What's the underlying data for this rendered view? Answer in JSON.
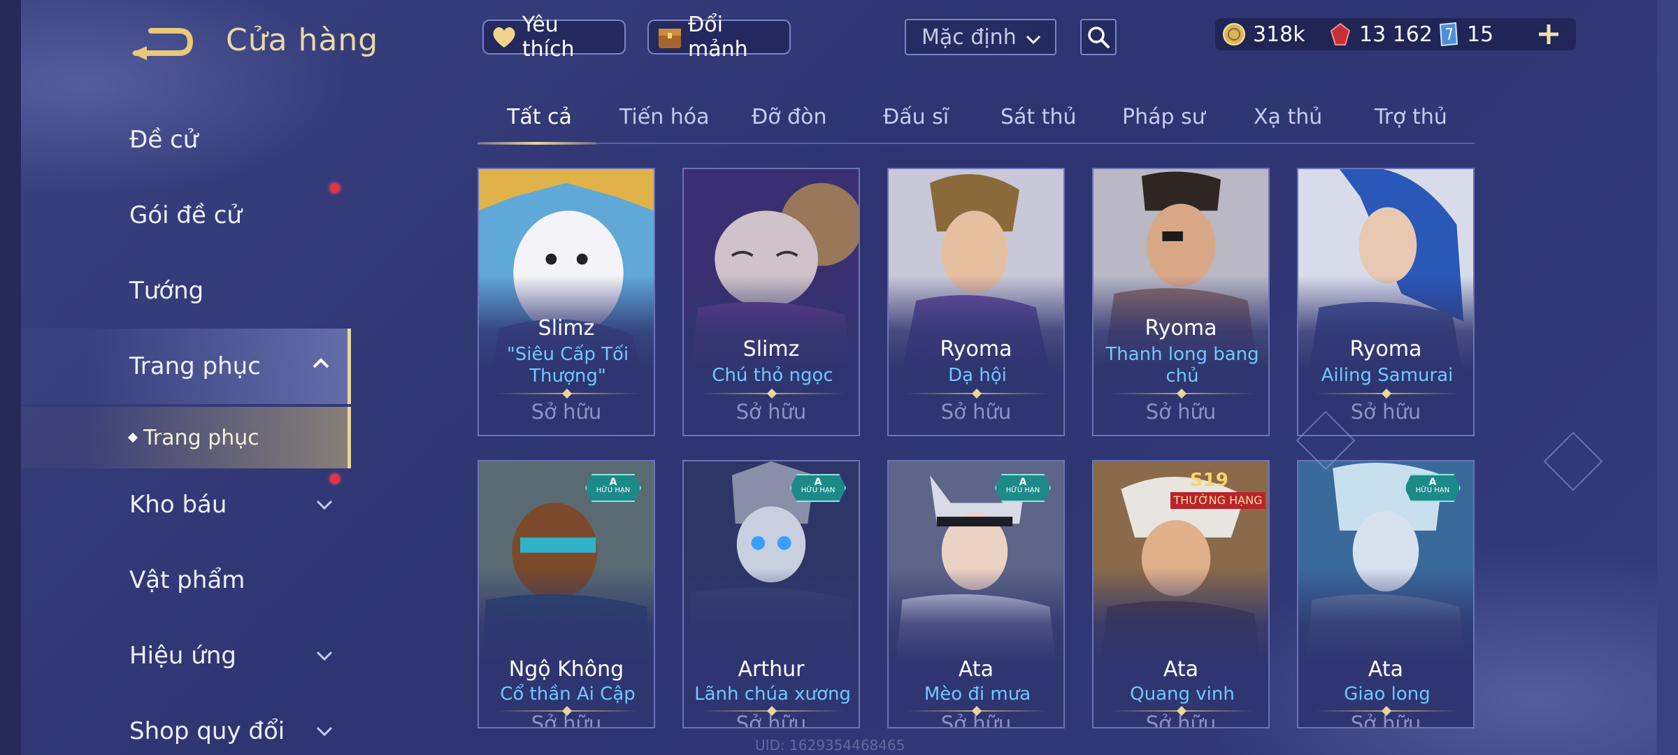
{
  "header": {
    "title": "Cửa hàng",
    "favorites_label": "Yêu thích",
    "shard_label": "Đổi mảnh",
    "sort_value": "Mặc định"
  },
  "currency": {
    "gold": "318k",
    "vouchers": "13 162",
    "tickets": "15"
  },
  "sidebar": {
    "items": [
      {
        "label": "Đề cử"
      },
      {
        "label": "Gói đề cử"
      },
      {
        "label": "Tướng"
      },
      {
        "label": "Trang phục"
      },
      {
        "label": "Kho báu"
      },
      {
        "label": "Vật phẩm"
      },
      {
        "label": "Hiệu ứng"
      },
      {
        "label": "Shop quy đổi"
      }
    ],
    "sub_item": "Trang phục"
  },
  "tabs": [
    "Tất cả",
    "Tiến hóa",
    "Đỡ đòn",
    "Đấu sĩ",
    "Sát thủ",
    "Pháp sư",
    "Xạ thủ",
    "Trợ thủ"
  ],
  "owned_label": "Sở hữu",
  "cards": [
    {
      "hero": "Slimz",
      "skin": "\"Siêu Cấp Tối Thượng\""
    },
    {
      "hero": "Slimz",
      "skin": "Chú thỏ ngọc"
    },
    {
      "hero": "Ryoma",
      "skin": "Dạ hội"
    },
    {
      "hero": "Ryoma",
      "skin": "Thanh long bang chủ"
    },
    {
      "hero": "Ryoma",
      "skin": "Ailing Samurai"
    },
    {
      "hero": "Ngộ Không",
      "skin": "Cổ thần Ai Cập"
    },
    {
      "hero": "Arthur",
      "skin": "Lãnh chúa xương"
    },
    {
      "hero": "Ata",
      "skin": "Mèo đi mưa"
    },
    {
      "hero": "Ata",
      "skin": "Quang vinh"
    },
    {
      "hero": "Ata",
      "skin": "Giao long"
    }
  ],
  "badges": {
    "a_rank": "A",
    "a_text": "HỮU HẠN",
    "s19": "S19",
    "s19_rank": "THƯỜNG HẠNG"
  },
  "watermark": "UID: 1629354468465",
  "colors": {
    "background": "#2d3470",
    "accent_gold": "#e9d69a",
    "skin_name_blue": "#6fc9ff",
    "notification_red": "#e43345"
  },
  "icons": [
    "back-arrow-icon",
    "heart-icon",
    "shard-chest-icon",
    "chevron-down-icon",
    "search-icon",
    "gold-coin-icon",
    "voucher-gem-icon",
    "ticket-icon",
    "plus-icon",
    "chevron-up-icon"
  ]
}
